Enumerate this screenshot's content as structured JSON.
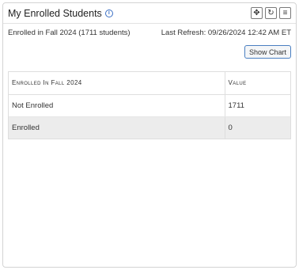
{
  "widget": {
    "title": "My Enrolled Students",
    "info_icon": "i",
    "tools": [
      {
        "name": "move-icon",
        "glyph": "✥"
      },
      {
        "name": "refresh-icon",
        "glyph": "↻"
      },
      {
        "name": "menu-icon",
        "glyph": "≡"
      }
    ]
  },
  "meta": {
    "enrolled_summary": "Enrolled in Fall 2024 (1711 students)",
    "last_refresh": "Last Refresh: 09/26/2024 12:42 AM ET"
  },
  "toolbar": {
    "show_chart_label": "Show Chart"
  },
  "table": {
    "headers": [
      "Enrolled In Fall 2024",
      "Value"
    ],
    "rows": [
      [
        "Not Enrolled",
        "1711"
      ],
      [
        "Enrolled",
        "0"
      ]
    ]
  }
}
